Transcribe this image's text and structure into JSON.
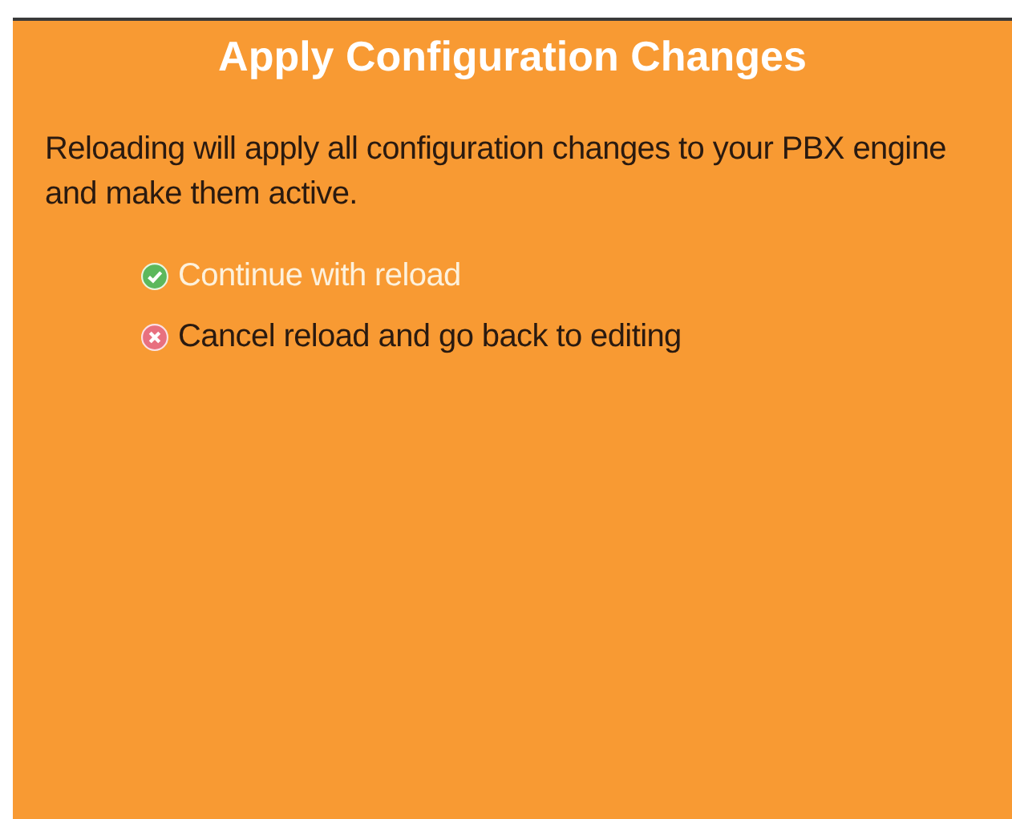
{
  "panel": {
    "title": "Apply Configuration Changes",
    "message": "Reloading will apply all configuration changes to your PBX engine and make them active.",
    "options": [
      {
        "kind": "confirm",
        "label": "Continue with reload",
        "highlighted": true
      },
      {
        "kind": "cancel",
        "label": "Cancel reload and go back to editing",
        "highlighted": false
      }
    ]
  }
}
